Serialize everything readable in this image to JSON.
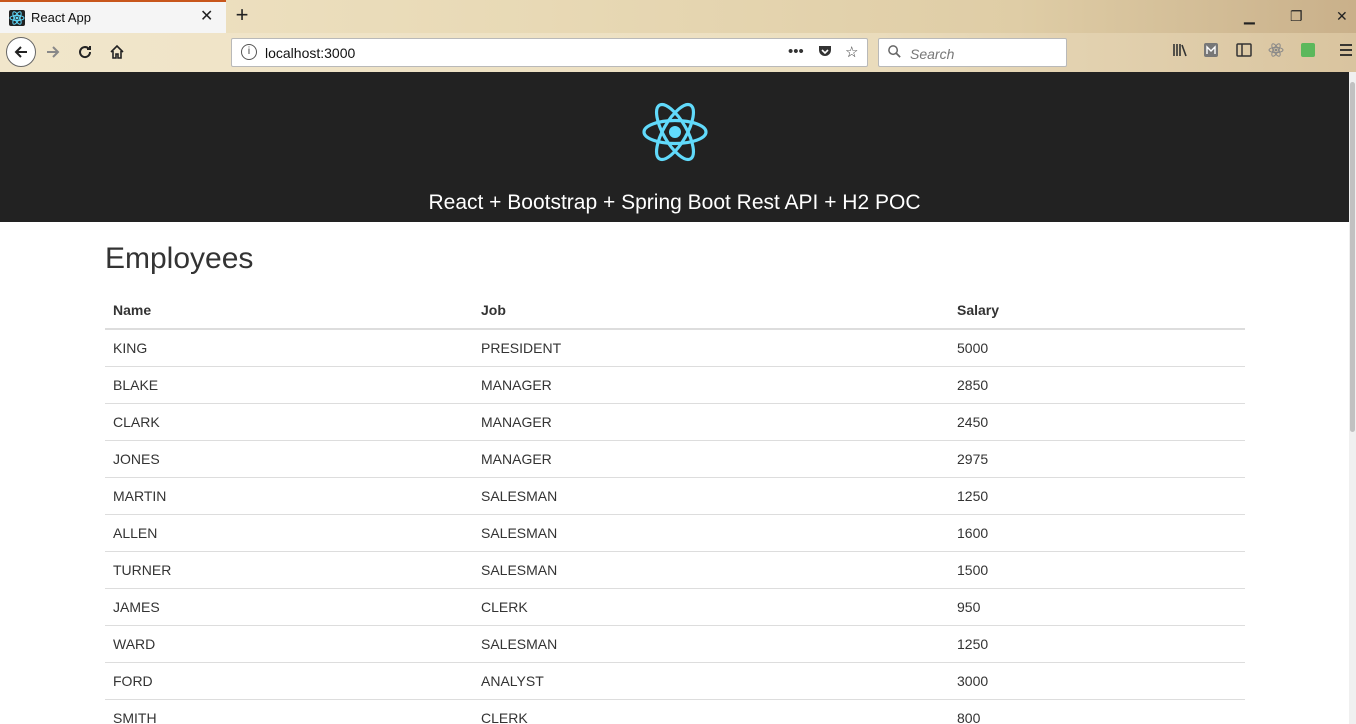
{
  "browser": {
    "tab_title": "React App",
    "tab_close": "✕",
    "new_tab": "+",
    "url": "localhost:3000",
    "search_placeholder": "Search",
    "more_label": "•••"
  },
  "app": {
    "header_title": "React + Bootstrap + Spring Boot Rest API + H2 POC",
    "logo_color": "#61dafb",
    "header_bg": "#222222"
  },
  "employees": {
    "title": "Employees",
    "columns": [
      "Name",
      "Job",
      "Salary"
    ],
    "rows": [
      [
        "KING",
        "PRESIDENT",
        "5000"
      ],
      [
        "BLAKE",
        "MANAGER",
        "2850"
      ],
      [
        "CLARK",
        "MANAGER",
        "2450"
      ],
      [
        "JONES",
        "MANAGER",
        "2975"
      ],
      [
        "MARTIN",
        "SALESMAN",
        "1250"
      ],
      [
        "ALLEN",
        "SALESMAN",
        "1600"
      ],
      [
        "TURNER",
        "SALESMAN",
        "1500"
      ],
      [
        "JAMES",
        "CLERK",
        "950"
      ],
      [
        "WARD",
        "SALESMAN",
        "1250"
      ],
      [
        "FORD",
        "ANALYST",
        "3000"
      ],
      [
        "SMITH",
        "CLERK",
        "800"
      ]
    ]
  }
}
